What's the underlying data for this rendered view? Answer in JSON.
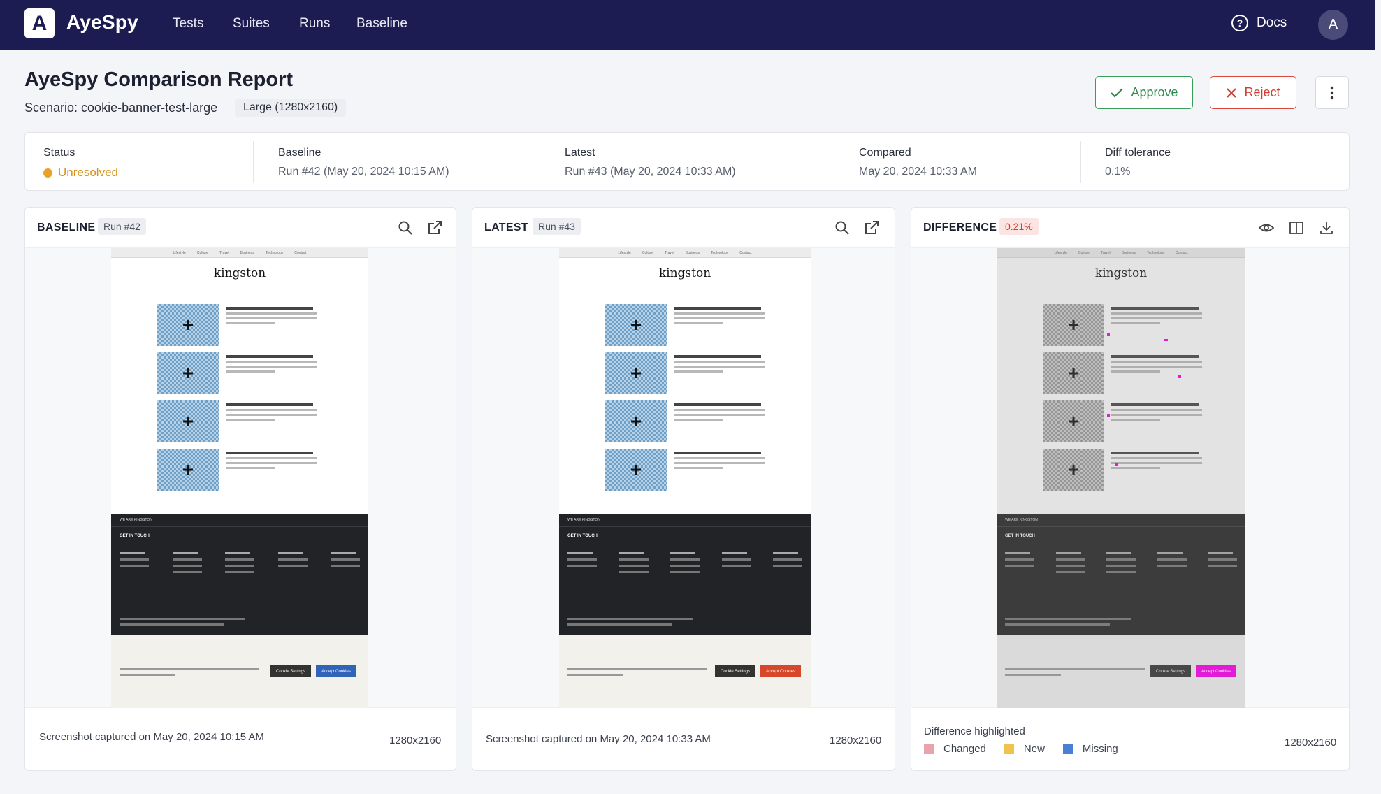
{
  "nav": {
    "logo_letter": "A",
    "brand": "AyeSpy",
    "links": [
      "Tests",
      "Suites",
      "Runs",
      "Baseline"
    ],
    "docs_label": "Docs",
    "avatar_initial": "A"
  },
  "header": {
    "title": "AyeSpy Comparison Report",
    "scenario": "Scenario: cookie-banner-test-large",
    "size_badge": "Large (1280x2160)",
    "approve_label": "Approve",
    "reject_label": "Reject"
  },
  "stats": {
    "status_label": "Status",
    "status_value": "Unresolved",
    "baseline_label": "Baseline",
    "baseline_value": "Run #42 (May 20, 2024 10:15 AM)",
    "latest_label": "Latest",
    "latest_value": "Run #43 (May 20, 2024 10:33 AM)",
    "compared_label": "Compared",
    "compared_value": "May 20, 2024 10:33 AM",
    "tolerance_label": "Diff tolerance",
    "tolerance_value": "0.1%"
  },
  "panels": {
    "baseline": {
      "title": "BASELINE",
      "run": "Run #42",
      "caption": "Screenshot captured on May 20, 2024 10:15 AM",
      "dims": "1280x2160"
    },
    "latest": {
      "title": "LATEST",
      "run": "Run #43",
      "caption": "Screenshot captured on May 20, 2024 10:33 AM",
      "dims": "1280x2160"
    },
    "difference": {
      "title": "DIFFERENCE",
      "percent": "0.21%",
      "caption": "Difference highlighted",
      "dims": "1280x2160",
      "legend": [
        {
          "label": "Changed",
          "color": "#e8a3ad"
        },
        {
          "label": "New",
          "color": "#f0c24e"
        },
        {
          "label": "Missing",
          "color": "#4a7fd6"
        }
      ]
    }
  },
  "mini_site": {
    "logo": "kingston",
    "footer_bar": "WE ARE KINGSTON",
    "footer_heading": "GET IN TOUCH",
    "cookie_settings": "Cookie Settings",
    "accept_cookies": "Accept Cookies"
  },
  "colors": {
    "nav_bg": "#1c1c52",
    "approve": "#2e8a4c",
    "reject": "#d13d33",
    "status_dot": "#e9a126",
    "accept_baseline": "#2f64b8",
    "accept_latest": "#d7472a",
    "accept_diff": "#e21bd6"
  }
}
